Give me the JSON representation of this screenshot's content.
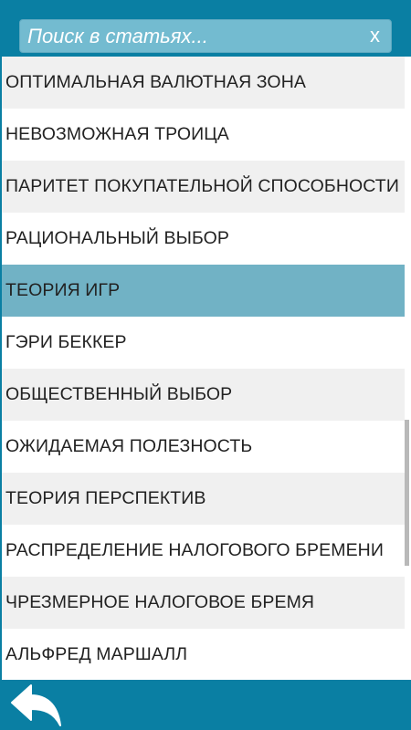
{
  "search": {
    "placeholder": "Поиск в статьях...",
    "clear_label": "x"
  },
  "articles": [
    {
      "label": "ОПТИМАЛЬНАЯ ВАЛЮТНАЯ ЗОНА"
    },
    {
      "label": "НЕВОЗМОЖНАЯ ТРОИЦА"
    },
    {
      "label": "ПАРИТЕТ ПОКУПАТЕЛЬНОЙ СПОСОБНОСТИ"
    },
    {
      "label": "РАЦИОНАЛЬНЫЙ ВЫБОР"
    },
    {
      "label": "ТЕОРИЯ ИГР"
    },
    {
      "label": "ГЭРИ БЕККЕР"
    },
    {
      "label": "ОБЩЕСТВЕННЫЙ ВЫБОР"
    },
    {
      "label": "ОЖИДАЕМАЯ ПОЛЕЗНОСТЬ"
    },
    {
      "label": "ТЕОРИЯ ПЕРСПЕКТИВ"
    },
    {
      "label": "РАСПРЕДЕЛЕНИЕ НАЛОГОВОГО БРЕМЕНИ"
    },
    {
      "label": "ЧРЕЗМЕРНОЕ НАЛОГОВОЕ БРЕМЯ"
    },
    {
      "label": "АЛЬФРЕД МАРШАЛЛ"
    }
  ],
  "selected_article": "ТЕОРИЯ ИГР",
  "bottom_bar": {
    "back_icon": "back-arrow-icon"
  },
  "colors": {
    "bar": "#0a7fa3",
    "search_field": "#73bbd0",
    "selected_row": "#71b2c5",
    "alt_row": "#f0f0f0"
  }
}
